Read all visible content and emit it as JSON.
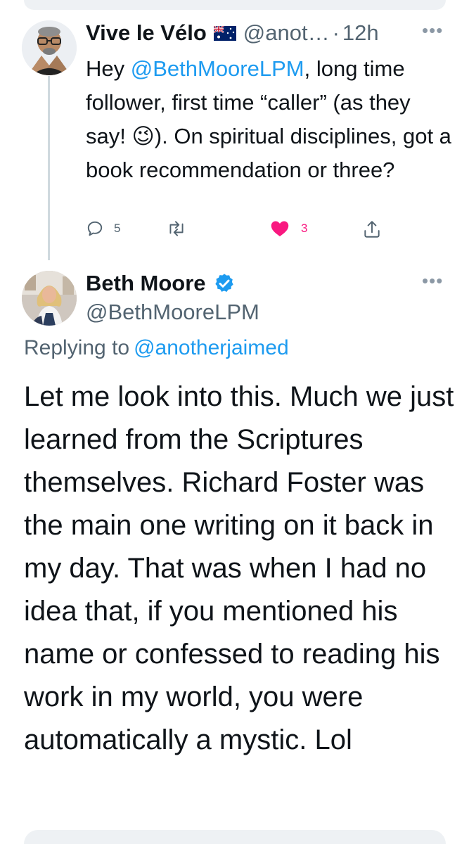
{
  "reply_tweet": {
    "display_name": "Vive le Vélo",
    "flag_icon": "australia-flag-icon",
    "handle": "@anot…",
    "separator": "·",
    "time": "12h",
    "more_icon": "more-dots-icon",
    "body_prefix": "Hey ",
    "mention": "@BethMooreLPM",
    "body_suffix": ", long time follower, first time “caller” (as they say! 😉). On spiritual disciplines, got a book recommendation or three?",
    "actions": {
      "reply_count": "5",
      "retweet_count": "",
      "like_count": "3",
      "like_color": "#f91880"
    }
  },
  "main_tweet": {
    "display_name": "Beth Moore",
    "verified_icon": "verified-badge-icon",
    "handle": "@BethMooreLPM",
    "more_icon": "more-dots-icon",
    "replying_label": "Replying to",
    "replying_mention": "@anotherjaimed",
    "body": "Let me look into this. Much we just learned from the Scriptures themselves. Richard Foster was the main one writing on it back in my day. That was when I had no idea that, if you mentioned his name or confessed to reading his work in my world, you were automatically a mystic. Lol"
  },
  "colors": {
    "link": "#1d9bf0",
    "secondary_text": "#536471",
    "primary_text": "#0f1419"
  }
}
